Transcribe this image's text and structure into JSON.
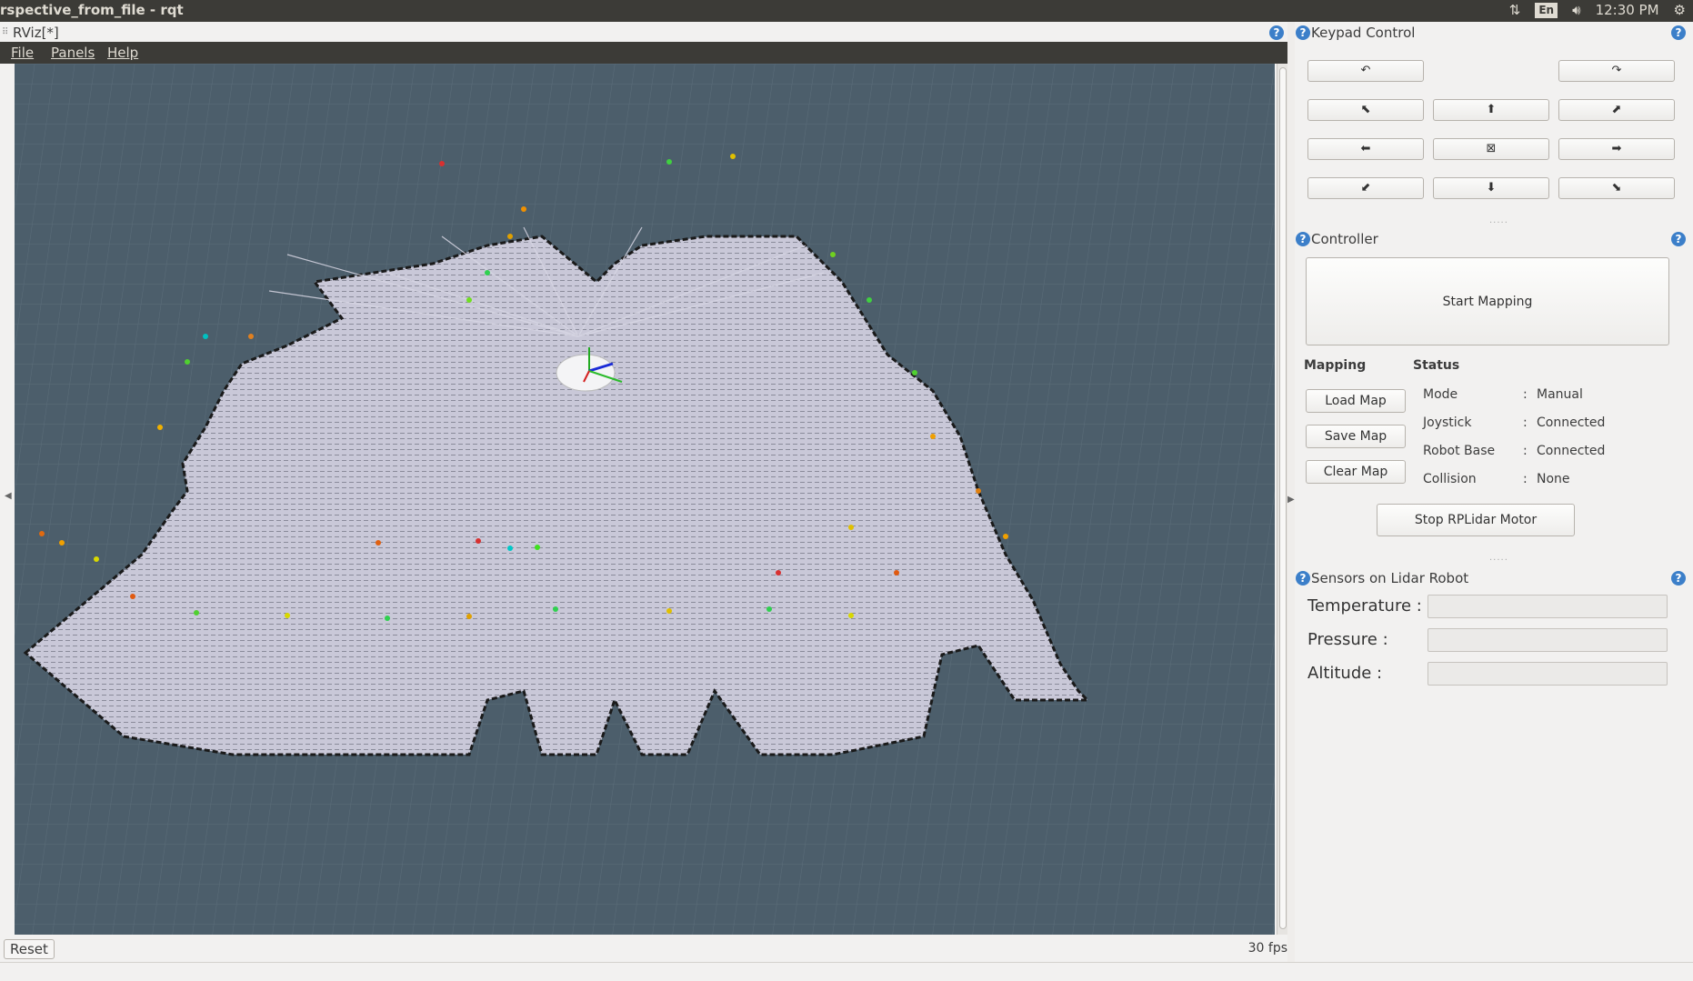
{
  "window": {
    "title": "rspective_from_file - rqt",
    "tray": {
      "network_icon": "updown-arrows-icon",
      "keyboard": "En",
      "volume_icon": "speaker-icon",
      "clock": "12:30 PM",
      "settings_icon": "gear-icon"
    }
  },
  "rviz": {
    "title": "RViz[*]",
    "menu": [
      "File",
      "Panels",
      "Help"
    ],
    "reset_label": "Reset",
    "fps": "30 fps"
  },
  "keypad": {
    "title": "Keypad Control",
    "buttons": {
      "rotate_left": "↶",
      "rotate_right": "↷",
      "up_left": "⬉",
      "up": "⬆",
      "up_right": "⬈",
      "left": "⬅",
      "stop": "⊠",
      "right": "➡",
      "down_left": "⬋",
      "down": "⬇",
      "down_right": "⬊"
    }
  },
  "controller": {
    "title": "Controller",
    "start_mapping": "Start Mapping",
    "mapping_label": "Mapping",
    "status_label": "Status",
    "load_map": "Load Map",
    "save_map": "Save Map",
    "clear_map": "Clear Map",
    "status": [
      {
        "key": "Mode",
        "sep": ":",
        "value": "Manual"
      },
      {
        "key": "Joystick",
        "sep": ":",
        "value": "Connected"
      },
      {
        "key": "Robot Base",
        "sep": ":",
        "value": "Connected"
      },
      {
        "key": "Collision",
        "sep": ":",
        "value": "None"
      }
    ],
    "stop_motor": "Stop RPLidar Motor"
  },
  "sensors": {
    "title": "Sensors on Lidar Robot",
    "items": [
      {
        "label": "Temperature :",
        "value": ""
      },
      {
        "label": "Pressure      :",
        "value": ""
      },
      {
        "label": "Altitude        :",
        "value": ""
      }
    ]
  },
  "colors": {
    "viewport_bg": "#4c5e6b",
    "grid_line": "#5d6f7c",
    "map_fill": "#c7c6d6",
    "topbar": "#3c3b37",
    "help_blue": "#3c7fc9"
  }
}
